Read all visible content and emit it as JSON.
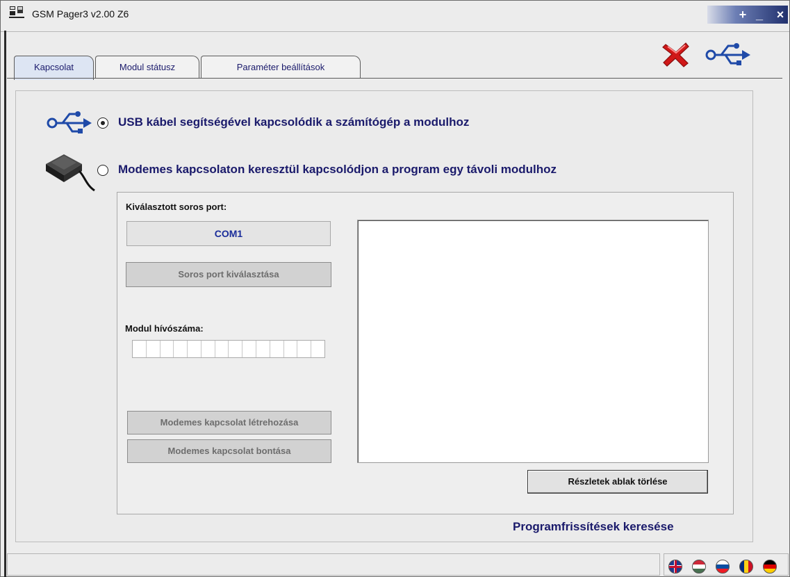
{
  "window": {
    "title": "GSM Pager3  v2.00 Z6"
  },
  "controls": {
    "minimize": "+",
    "restore": "_",
    "close": "×"
  },
  "tabs": [
    {
      "label": "Kapcsolat",
      "active": true
    },
    {
      "label": "Modul státusz",
      "active": false
    },
    {
      "label": "Paraméter beállítások",
      "active": false
    }
  ],
  "connection": {
    "usb_option": "USB kábel segítségével kapcsolódik a számítógép a modulhoz",
    "modem_option": "Modemes kapcsolaton keresztül kapcsolódjon a program egy távoli modulhoz",
    "selected": "usb"
  },
  "serial": {
    "label": "Kiválasztott soros port:",
    "value": "COM1",
    "select_button": "Soros port kiválasztása"
  },
  "phone": {
    "label": "Modul hívószáma:",
    "digit_slots": 14
  },
  "modem_buttons": {
    "connect": "Modemes kapcsolat létrehozása",
    "disconnect": "Modemes kapcsolat bontása"
  },
  "details": {
    "clear_button": "Részletek ablak törlése"
  },
  "update_link": "Programfrissítések keresése",
  "colors": {
    "accent": "#1a1a6b",
    "usb_blue": "#1f4aa8",
    "close_red": "#d01818"
  },
  "icons": [
    "app-icon",
    "disconnect-x-icon",
    "usb-icon",
    "modem-device-icon"
  ],
  "languages": [
    "en",
    "hu",
    "sk",
    "ro",
    "de"
  ]
}
